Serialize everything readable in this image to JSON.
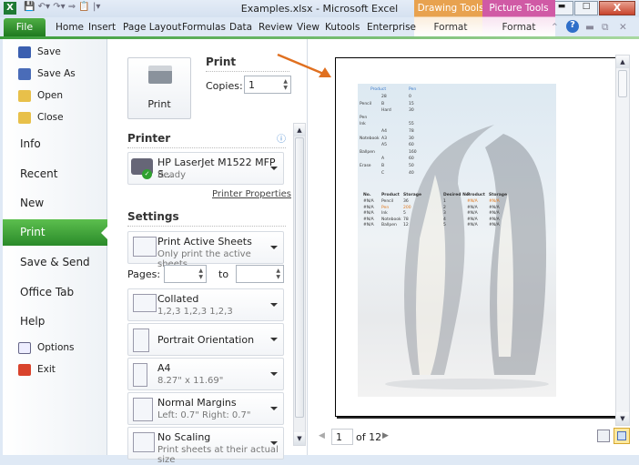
{
  "window": {
    "title": "Examples.xlsx  -  Microsoft Excel",
    "contextual": [
      {
        "group": "Drawing Tools",
        "tab": "Format",
        "color": "#e8a24f"
      },
      {
        "group": "Picture Tools",
        "tab": "Format",
        "color": "#d05aa5"
      }
    ]
  },
  "ribbon": {
    "file": "File",
    "tabs": [
      "Home",
      "Insert",
      "Page Layout",
      "Formulas",
      "Data",
      "Review",
      "View",
      "Kutools",
      "Enterprise"
    ]
  },
  "nav": {
    "small_top": [
      "Save",
      "Save As",
      "Open",
      "Close"
    ],
    "big": [
      "Info",
      "Recent",
      "New",
      "Print",
      "Save & Send",
      "Office Tab",
      "Help"
    ],
    "small_bottom": [
      "Options",
      "Exit"
    ],
    "active": "Print",
    "accent": "#3a9a35"
  },
  "print": {
    "button": "Print",
    "heading": "Print",
    "copies_label": "Copies:",
    "copies": "1"
  },
  "printer": {
    "heading": "Printer",
    "name": "HP LaserJet M1522 MFP S...",
    "status": "Ready",
    "properties": "Printer Properties"
  },
  "settings": {
    "heading": "Settings",
    "pages_label": "Pages:",
    "to_label": "to",
    "items": [
      {
        "title": "Print Active Sheets",
        "sub": "Only print the active sheets"
      },
      {
        "title": "Collated",
        "sub": "1,2,3    1,2,3    1,2,3"
      },
      {
        "title": "Portrait Orientation",
        "sub": ""
      },
      {
        "title": "A4",
        "sub": "8.27\" x 11.69\""
      },
      {
        "title": "Normal Margins",
        "sub": "Left:  0.7\"    Right:  0.7\""
      },
      {
        "title": "No Scaling",
        "sub": "Print sheets at their actual size"
      }
    ]
  },
  "preview": {
    "table1": {
      "headers": [
        "Product",
        "Pen"
      ],
      "rows": [
        [
          "",
          "28",
          "0"
        ],
        [
          "Pencil",
          "B",
          "15"
        ],
        [
          "",
          "Hard",
          "30"
        ],
        [
          "Pen",
          "",
          ""
        ],
        [
          "Ink",
          "",
          "55"
        ],
        [
          "",
          "A4",
          "78"
        ],
        [
          "Notebook",
          "A3",
          "30"
        ],
        [
          "",
          "A5",
          "60"
        ],
        [
          "Ballpen",
          "",
          "160"
        ],
        [
          "",
          "A",
          "60"
        ],
        [
          "Erase",
          "B",
          "50"
        ],
        [
          "",
          "C",
          "40"
        ]
      ]
    },
    "table2": {
      "headers": [
        "No.",
        "Product",
        "Storage"
      ],
      "rows": [
        [
          "#N/A",
          "Pencil",
          "36"
        ],
        [
          "#N/A",
          "Pen",
          "200"
        ],
        [
          "#N/A",
          "Ink",
          "5"
        ],
        [
          "#N/A",
          "Notebook",
          "78"
        ],
        [
          "#N/A",
          "Ballpen",
          "12"
        ]
      ]
    },
    "table3": {
      "headers": [
        "Desired No.",
        "Product",
        "Storage"
      ],
      "rows": [
        [
          "1",
          "#N/A",
          "#N/A"
        ],
        [
          "2",
          "#N/A",
          "#N/A"
        ],
        [
          "3",
          "#N/A",
          "#N/A"
        ],
        [
          "4",
          "#N/A",
          "#N/A"
        ],
        [
          "5",
          "#N/A",
          "#N/A"
        ]
      ]
    }
  },
  "pager": {
    "current": "1",
    "of": "of 12"
  }
}
